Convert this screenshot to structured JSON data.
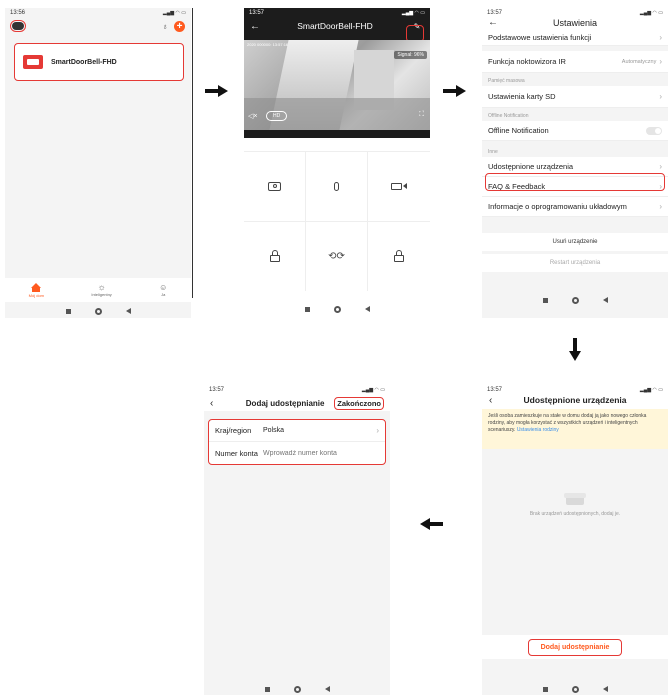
{
  "phone1": {
    "time": "13:56",
    "device_name": "SmartDoorBell-FHD",
    "tabs": [
      {
        "label": "Mój dom",
        "icon": "home-icon"
      },
      {
        "label": "Inteligentny",
        "icon": "sun-icon"
      },
      {
        "label": "Ja",
        "icon": "user-icon"
      }
    ]
  },
  "phone2": {
    "time": "13:57",
    "title": "SmartDoorBell-FHD",
    "timestamp": "2020 000000: 13:57:16",
    "signal": "Signal: 96%",
    "hd_label": "HD"
  },
  "phone3": {
    "time": "13:57",
    "title": "Ustawienia",
    "rows_top": [
      {
        "label": "Podstawowe ustawienia funkcji",
        "value": ""
      },
      {
        "label": "Funkcja noktowizora IR",
        "value": "Automatyczny"
      }
    ],
    "section_storage": "Pamięć masowa",
    "row_sd": "Ustawienia karty SD",
    "section_offline": "Offline Notification",
    "row_offline": "Offline Notification",
    "section_other": "Inne",
    "rows_other": [
      {
        "label": "Udostępnione urządzenia"
      },
      {
        "label": "FAQ & Feedback"
      },
      {
        "label": "Informacje o oprogramowaniu układowym"
      }
    ],
    "remove_label": "Usuń urządzenie",
    "restart_label": "Restart urządzenia"
  },
  "phone4": {
    "time": "13:57",
    "title": "Dodaj udostępnianie",
    "done_label": "Zakończono",
    "fields": [
      {
        "label": "Kraj/region",
        "value": "Polska",
        "placeholder": ""
      },
      {
        "label": "Numer konta",
        "value": "",
        "placeholder": "Wprowadź numer konta"
      }
    ]
  },
  "phone5": {
    "time": "13:57",
    "title": "Udostępnione urządzenia",
    "info_text": "Jeśli osoba zamieszkuje na stałe w domu dodaj ją jako nowego członka rodziny, aby mogła korzystać z wszystkich urządzeń i inteligentnych scenariuszy.",
    "info_link": "Ustawienia rodziny",
    "empty_text": "Brak urządzeń udostępnionych, dodaj je.",
    "add_button": "Dodaj udostępnianie"
  },
  "colors": {
    "accent": "#ff5a1f",
    "highlight": "#e53935",
    "link": "#3b8ee8",
    "info_bg": "#fff6d9"
  }
}
